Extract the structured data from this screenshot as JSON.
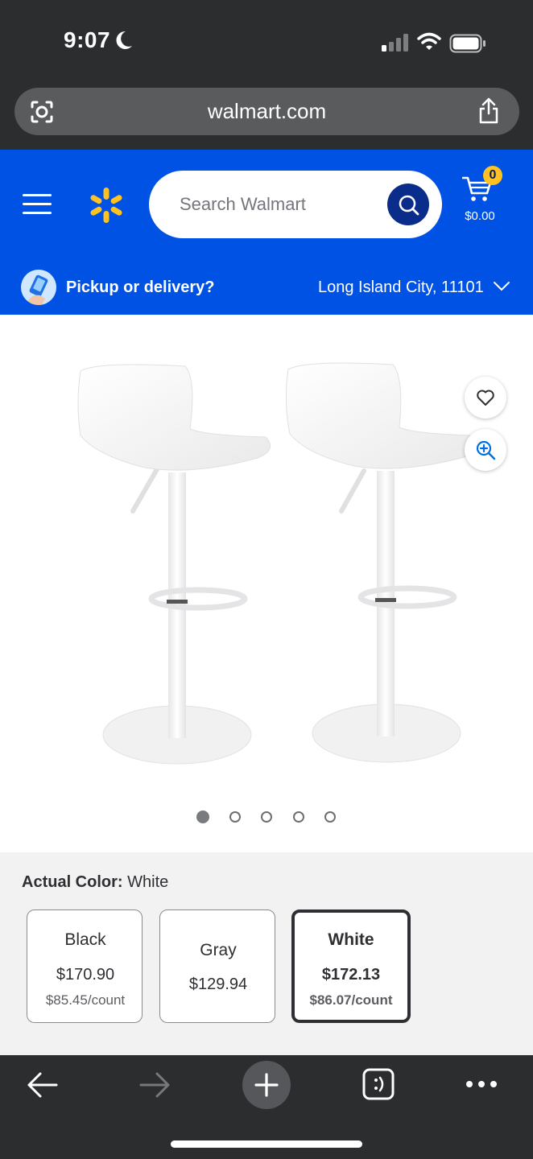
{
  "status_bar": {
    "time": "9:07"
  },
  "browser": {
    "url": "walmart.com"
  },
  "header": {
    "search_placeholder": "Search Walmart",
    "cart_count": "0",
    "cart_total": "$0.00",
    "pickup_label": "Pickup or delivery?",
    "location": "Long Island City, 11101"
  },
  "gallery": {
    "image_count": 5,
    "active_index": 0
  },
  "variants": {
    "label": "Actual Color:",
    "selected_value": "White",
    "options": [
      {
        "name": "Black",
        "price": "$170.90",
        "unit_price": "$85.45/count",
        "selected": false
      },
      {
        "name": "Gray",
        "price": "$129.94",
        "unit_price": "",
        "selected": false
      },
      {
        "name": "White",
        "price": "$172.13",
        "unit_price": "$86.07/count",
        "selected": true
      }
    ]
  },
  "colors": {
    "walmart_blue": "#0052e4",
    "spark_yellow": "#ffc220",
    "chrome_dark": "#2c2d2f"
  },
  "icons": [
    "camera-lens-icon",
    "share-icon",
    "hamburger-menu-icon",
    "walmart-spark-icon",
    "search-icon",
    "cart-icon",
    "chevron-down-icon",
    "heart-icon",
    "zoom-in-icon",
    "back-arrow-icon",
    "forward-arrow-icon",
    "plus-icon",
    "tabs-icon",
    "more-icon"
  ]
}
